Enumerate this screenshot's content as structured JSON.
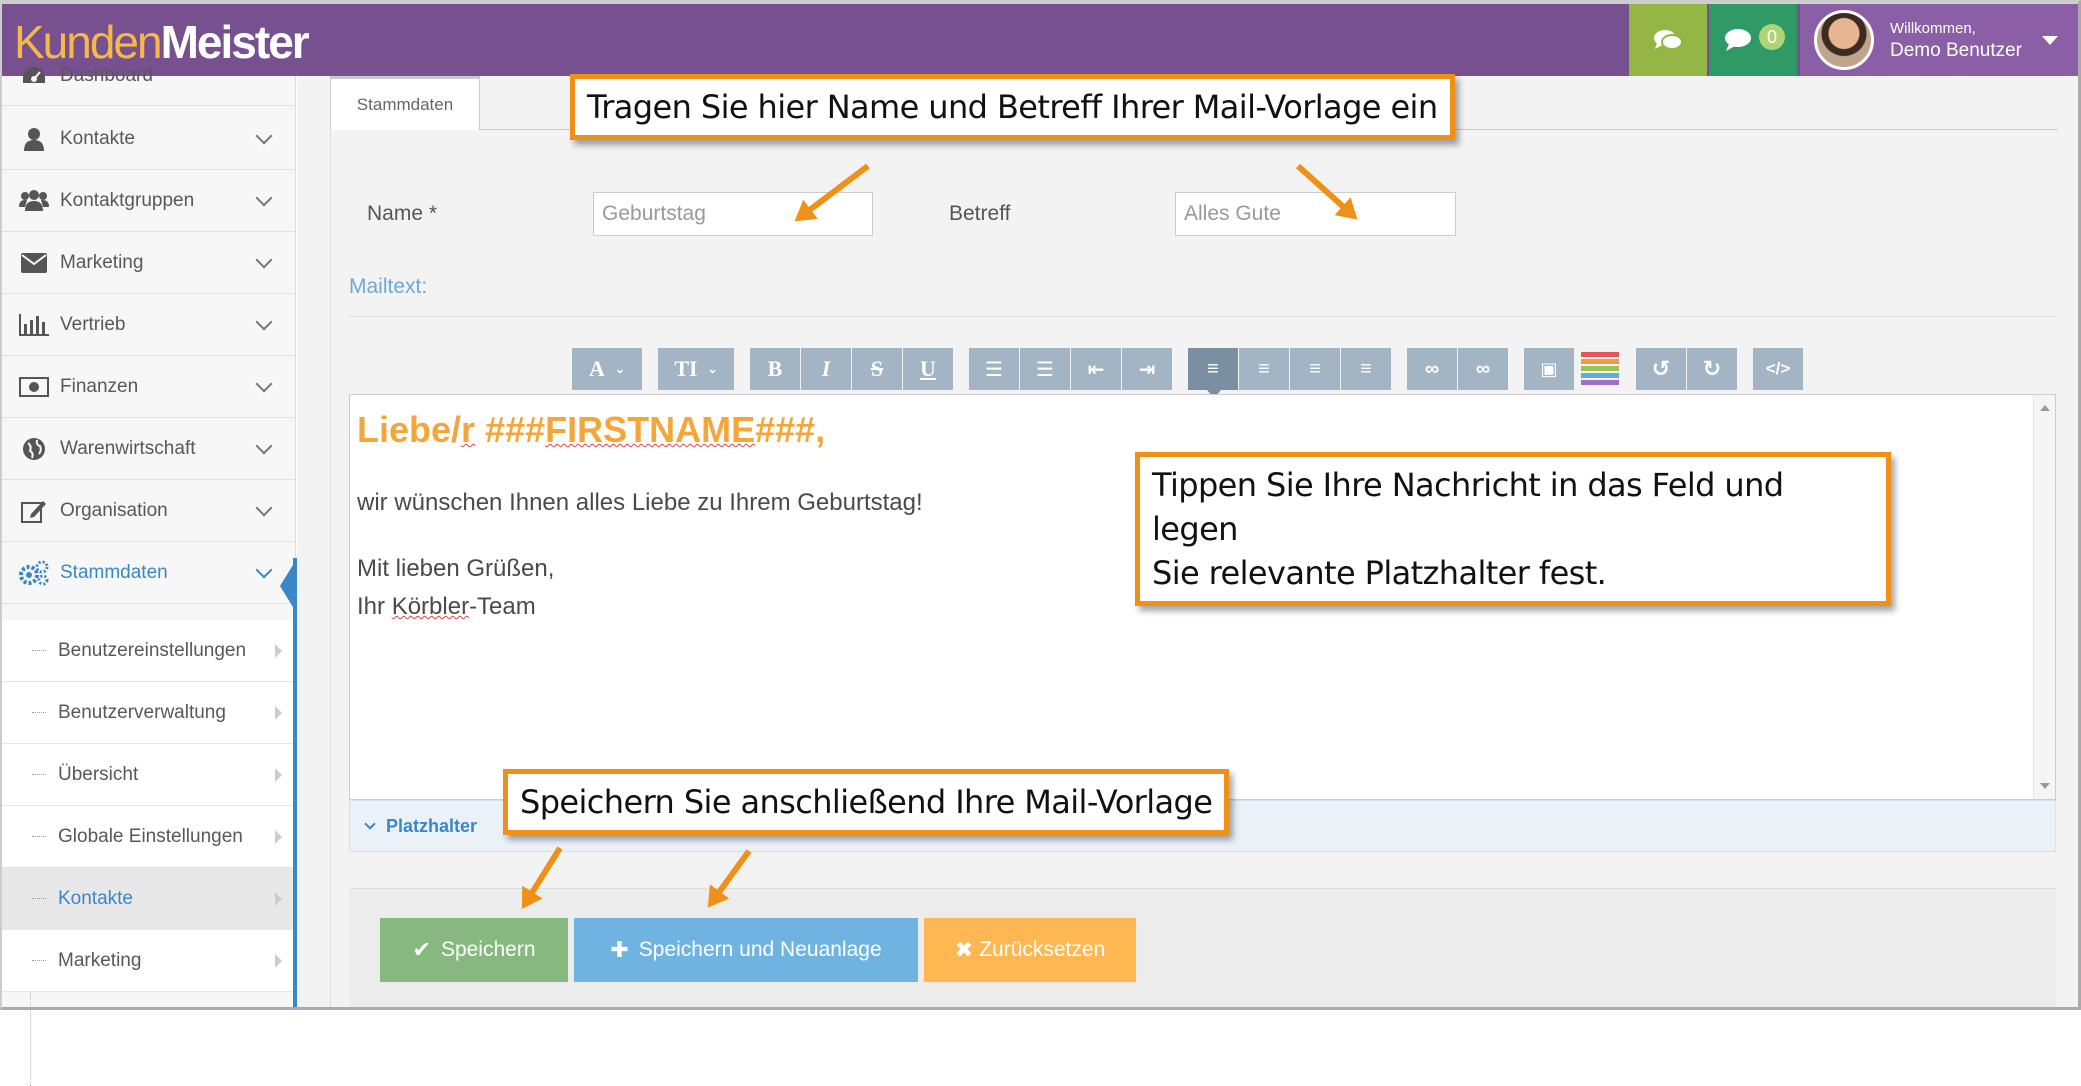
{
  "header": {
    "logo_part1": "Kunden",
    "logo_part2": "Meister",
    "chat_icon": "chat-bubbles-icon",
    "message_icon": "message-icon",
    "message_count": "0",
    "welcome": "Willkommen,",
    "user_name": "Demo Benutzer"
  },
  "sidebar": {
    "items": [
      {
        "label": "Dashboard",
        "icon": "dashboard-icon"
      },
      {
        "label": "Kontakte",
        "icon": "user-icon"
      },
      {
        "label": "Kontaktgruppen",
        "icon": "users-icon"
      },
      {
        "label": "Marketing",
        "icon": "envelope-icon"
      },
      {
        "label": "Vertrieb",
        "icon": "bar-chart-icon"
      },
      {
        "label": "Finanzen",
        "icon": "money-icon"
      },
      {
        "label": "Warenwirtschaft",
        "icon": "globe-icon"
      },
      {
        "label": "Organisation",
        "icon": "edit-icon"
      },
      {
        "label": "Stammdaten",
        "icon": "cogs-icon"
      }
    ],
    "subitems": [
      {
        "label": "Benutzereinstellungen"
      },
      {
        "label": "Benutzerverwaltung"
      },
      {
        "label": "Übersicht"
      },
      {
        "label": "Globale Einstellungen"
      },
      {
        "label": "Kontakte"
      },
      {
        "label": "Marketing"
      }
    ]
  },
  "main": {
    "tab": "Stammdaten",
    "name_label": "Name *",
    "name_value": "Geburtstag",
    "subject_label": "Betreff",
    "subject_value": "Alles Gute",
    "mailtext_label": "Mailtext:",
    "editor": {
      "heading_pre": "Liebe/",
      "heading_r": "r",
      "heading_mid": " ###",
      "heading_name": "FIRSTNAME",
      "heading_post": "###,",
      "line1": "wir wünschen Ihnen alles Liebe zu Ihrem Geburtstag!",
      "line2": "Mit lieben Grüßen,",
      "line3_pre": "Ihr ",
      "line3_name": "Körbler",
      "line3_post": "-Team"
    },
    "placeholder_section": "Platzhalter",
    "toolbar": [
      "font-icon",
      "text-size-icon",
      "bold-icon",
      "italic-icon",
      "strikethrough-icon",
      "underline-icon",
      "bullet-list-icon",
      "numbered-list-icon",
      "outdent-icon",
      "indent-icon",
      "align-left-icon",
      "align-center-icon",
      "align-right-icon",
      "justify-icon",
      "link-icon",
      "unlink-icon",
      "image-icon",
      "color-icon",
      "undo-icon",
      "redo-icon",
      "code-icon"
    ],
    "buttons": {
      "save": "Speichern",
      "save_new": "Speichern und Neuanlage",
      "reset": "Zurücksetzen"
    }
  },
  "callouts": {
    "top": "Tragen Sie hier Name und Betreff Ihrer Mail-Vorlage ein",
    "middle_line1": "Tippen Sie Ihre Nachricht in das Feld und legen",
    "middle_line2": "Sie relevante Platzhalter fest.",
    "bottom": "Speichern Sie anschließend Ihre Mail-Vorlage"
  },
  "colors": {
    "header": "#77508f",
    "accent": "#ef9119",
    "active": "#3a87c8",
    "save": "#87b87f",
    "save_new": "#6fb3e0",
    "reset": "#ffb752"
  }
}
